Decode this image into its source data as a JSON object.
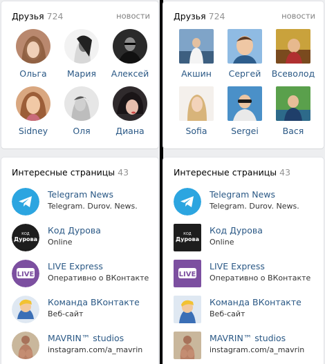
{
  "friends": {
    "title": "Друзья",
    "count": "724",
    "link": "новости",
    "left_names": [
      "Ольга",
      "Мария",
      "Алексей",
      "Sidney",
      "Оля",
      "Диана"
    ],
    "right_names": [
      "Акшин",
      "Сергей",
      "Всеволод",
      "Sofia",
      "Sergei",
      "Вася"
    ]
  },
  "pages": {
    "title": "Интересные страницы",
    "count": "43",
    "items": [
      {
        "title": "Telegram News",
        "subtitle": "Telegram. Durov. News."
      },
      {
        "title": "Код Дурова",
        "subtitle": "Online",
        "icon_text": "Дурова",
        "icon_small": "КОД"
      },
      {
        "title": "LIVE Express",
        "subtitle": "Оперативно о ВКонтакте",
        "icon_text": "LIVE"
      },
      {
        "title": "Команда ВКонтакте",
        "subtitle": "Веб-сайт"
      },
      {
        "title": "MAVRIN™ studios",
        "subtitle": "instagram.com/a_mavrin"
      }
    ]
  },
  "colors": {
    "link": "#2a5885",
    "telegram": "#2ca5e0",
    "live": "#7c4fa0"
  }
}
